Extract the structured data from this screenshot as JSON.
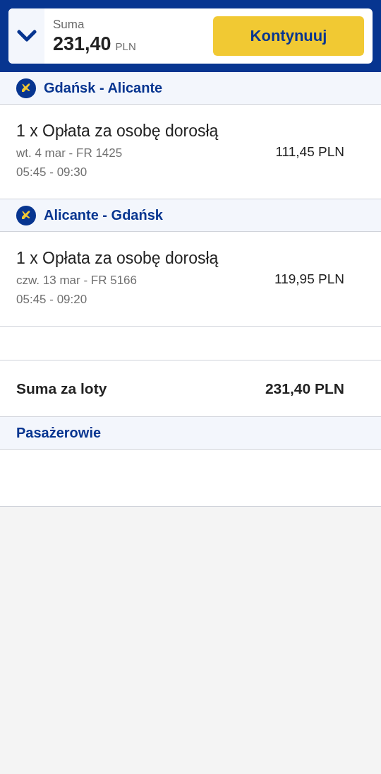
{
  "summary_bar": {
    "label": "Suma",
    "amount": "231,40",
    "currency": "PLN",
    "button": "Kontynuuj"
  },
  "flights": [
    {
      "route": "Gdańsk - Alicante",
      "item": "1 x Opłata za osobę dorosłą",
      "date": "wt. 4 mar - FR 1425",
      "time": "05:45 - 09:30",
      "price": "111,45 PLN"
    },
    {
      "route": "Alicante - Gdańsk",
      "item": "1 x Opłata za osobę dorosłą",
      "date": "czw. 13 mar - FR 5166",
      "time": "05:45 - 09:20",
      "price": "119,95 PLN"
    }
  ],
  "total": {
    "label": "Suma za loty",
    "amount": "231,40 PLN"
  },
  "passengers": {
    "title": "Pasażerowie"
  }
}
